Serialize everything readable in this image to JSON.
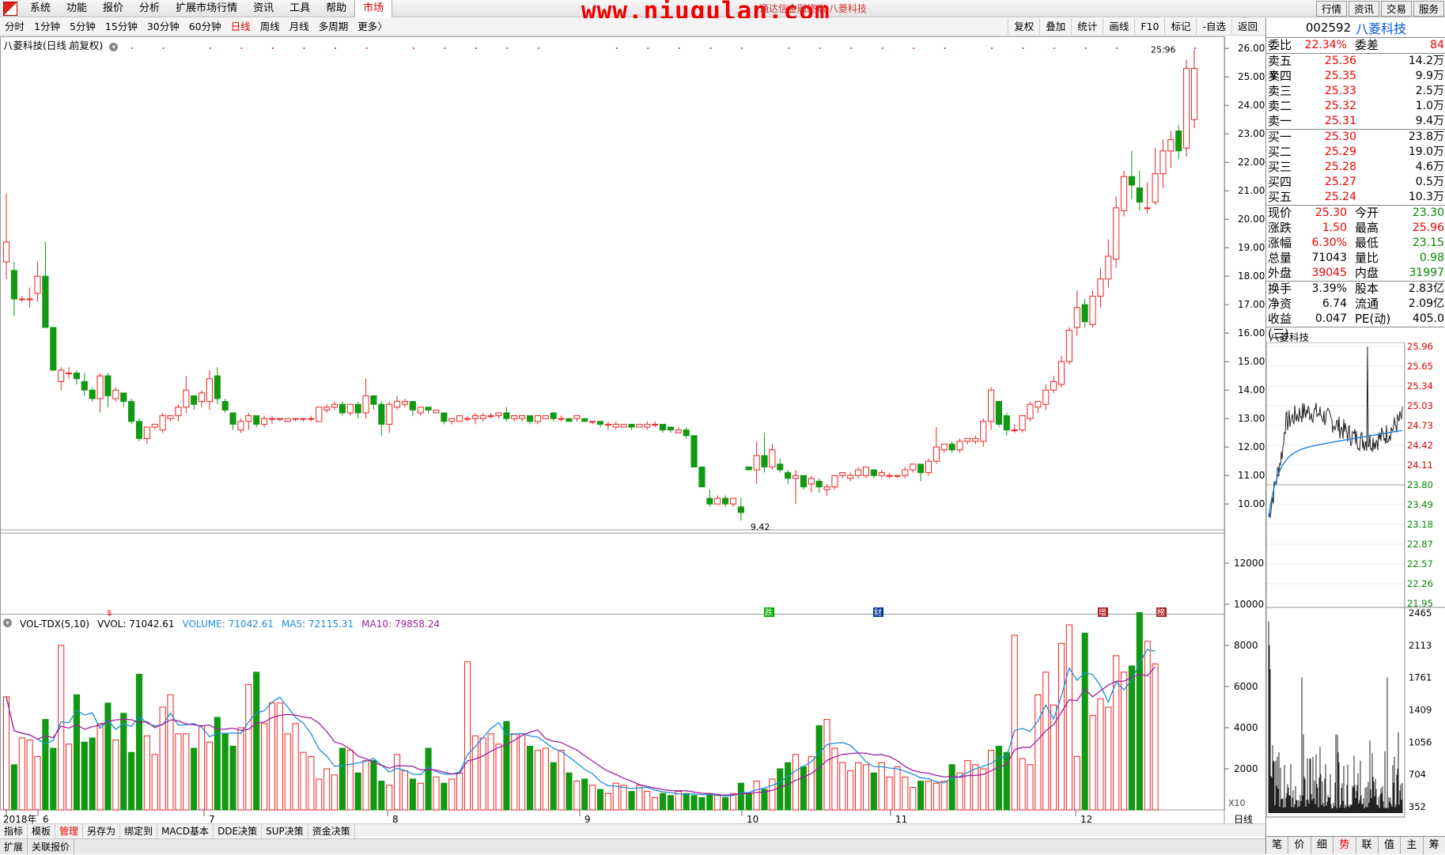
{
  "menu": {
    "items": [
      "系统",
      "功能",
      "报价",
      "分析",
      "扩展市场行情",
      "资讯",
      "工具",
      "帮助"
    ],
    "active": "市场",
    "right_tabs": [
      "行情",
      "资讯",
      "交易",
      "服务"
    ]
  },
  "watermark": "www.niugulan.com",
  "watermark_sub": "通达信金融终端  八菱科技",
  "periods": [
    "分时",
    "1分钟",
    "5分钟",
    "15分钟",
    "30分钟",
    "60分钟",
    "日线",
    "周线",
    "月线",
    "多周期",
    "更多〉"
  ],
  "period_active": "日线",
  "tools": [
    "复权",
    "叠加",
    "统计",
    "画线",
    "F10",
    "标记",
    "-自选",
    "返回"
  ],
  "chart_title": "八菱科技(日线 前复权)",
  "colors": {
    "up": "#ee2222",
    "down": "#119911",
    "ma5": "#1a8fdb",
    "ma10": "#a020a0",
    "axis_red": "#dd0000"
  },
  "chart_data": {
    "type": "candlestick",
    "y_ticks": [
      "26.00",
      "25.00",
      "24.00",
      "23.00",
      "22.00",
      "21.00",
      "20.00",
      "19.00",
      "18.00",
      "17.00",
      "16.00",
      "15.00",
      "14.00",
      "13.00",
      "12.00",
      "11.00",
      "10.00"
    ],
    "ylim": [
      9.2,
      26.2
    ],
    "high_label": "25.96",
    "low_label": "9.42",
    "x_labels": [
      "2018年",
      "6",
      "7",
      "8",
      "9",
      "10",
      "11",
      "12"
    ],
    "x_period": "日线",
    "candles": [
      [
        18.5,
        19.2,
        17.9,
        20.9
      ],
      [
        18.2,
        17.2,
        16.6,
        18.5
      ],
      [
        17.2,
        17.2,
        17.1,
        17.3
      ],
      [
        17.2,
        17.2,
        16.9,
        17.6
      ],
      [
        17.4,
        18.0,
        17.1,
        18.5
      ],
      [
        18.0,
        16.2,
        16.2,
        19.2
      ],
      [
        16.2,
        14.7,
        14.7,
        16.2
      ],
      [
        14.3,
        14.7,
        14.0,
        14.8
      ],
      [
        14.6,
        14.6,
        14.4,
        14.8
      ],
      [
        14.6,
        14.4,
        14.2,
        14.7
      ],
      [
        14.3,
        14.0,
        13.8,
        14.6
      ],
      [
        14.0,
        13.7,
        13.6,
        14.1
      ],
      [
        13.7,
        14.5,
        13.2,
        14.6
      ],
      [
        14.5,
        13.8,
        13.4,
        14.6
      ],
      [
        13.7,
        14.0,
        13.6,
        14.1
      ],
      [
        13.9,
        13.6,
        13.4,
        13.9
      ],
      [
        13.6,
        12.9,
        12.8,
        13.7
      ],
      [
        12.9,
        12.3,
        12.2,
        13.0
      ],
      [
        12.3,
        12.7,
        12.1,
        12.7
      ],
      [
        12.7,
        12.8,
        12.6,
        12.8
      ],
      [
        12.6,
        13.1,
        12.5,
        13.2
      ],
      [
        13.0,
        13.1,
        12.9,
        13.1
      ],
      [
        13.1,
        13.4,
        12.9,
        13.5
      ],
      [
        13.4,
        14.0,
        13.2,
        14.5
      ],
      [
        13.8,
        13.5,
        13.3,
        13.8
      ],
      [
        13.6,
        13.9,
        13.4,
        14.0
      ],
      [
        13.6,
        14.4,
        13.3,
        14.7
      ],
      [
        14.5,
        13.7,
        13.5,
        14.8
      ],
      [
        13.6,
        13.3,
        13.2,
        13.7
      ],
      [
        13.2,
        12.8,
        12.6,
        13.2
      ],
      [
        12.6,
        12.9,
        12.5,
        13.0
      ],
      [
        12.9,
        13.1,
        12.6,
        13.2
      ],
      [
        13.1,
        12.8,
        12.7,
        13.1
      ],
      [
        12.8,
        13.0,
        12.7,
        13.1
      ],
      [
        13.0,
        13.0,
        12.8,
        13.1
      ],
      [
        13.0,
        13.0,
        12.9,
        13.0
      ],
      [
        12.9,
        13.0,
        12.9,
        13.0
      ],
      [
        13.0,
        13.0,
        12.9,
        13.0
      ],
      [
        13.0,
        13.0,
        12.9,
        13.0
      ],
      [
        13.0,
        13.0,
        12.9,
        13.1
      ],
      [
        12.9,
        13.4,
        12.9,
        13.4
      ],
      [
        13.3,
        13.4,
        13.2,
        13.5
      ],
      [
        13.4,
        13.5,
        13.3,
        13.6
      ],
      [
        13.5,
        13.2,
        13.1,
        13.6
      ],
      [
        13.2,
        13.5,
        13.1,
        13.5
      ],
      [
        13.5,
        13.2,
        13.0,
        13.6
      ],
      [
        13.2,
        13.8,
        13.0,
        14.4
      ],
      [
        13.8,
        13.5,
        13.3,
        13.8
      ],
      [
        13.5,
        12.8,
        12.4,
        13.6
      ],
      [
        12.8,
        13.5,
        12.5,
        13.6
      ],
      [
        13.4,
        13.6,
        13.3,
        13.8
      ],
      [
        13.5,
        13.6,
        13.4,
        13.7
      ],
      [
        13.6,
        13.3,
        13.1,
        13.6
      ],
      [
        13.2,
        13.4,
        13.1,
        13.4
      ],
      [
        13.4,
        13.3,
        13.2,
        13.4
      ],
      [
        13.2,
        13.3,
        13.2,
        13.3
      ],
      [
        13.2,
        12.9,
        12.8,
        13.2
      ],
      [
        12.9,
        13.0,
        12.8,
        13.0
      ],
      [
        12.9,
        13.1,
        12.9,
        13.1
      ],
      [
        13.0,
        13.0,
        12.9,
        13.1
      ],
      [
        13.0,
        13.1,
        12.8,
        13.2
      ],
      [
        13.0,
        13.1,
        12.9,
        13.2
      ],
      [
        13.1,
        13.1,
        13.0,
        13.2
      ],
      [
        13.1,
        13.2,
        13.0,
        13.2
      ],
      [
        13.2,
        13.0,
        12.9,
        13.4
      ],
      [
        13.0,
        13.1,
        12.9,
        13.1
      ],
      [
        13.0,
        13.1,
        12.9,
        13.1
      ],
      [
        13.1,
        12.9,
        12.8,
        13.1
      ],
      [
        12.9,
        13.1,
        12.8,
        13.1
      ],
      [
        13.0,
        13.1,
        13.0,
        13.1
      ],
      [
        13.2,
        13.0,
        12.9,
        13.2
      ],
      [
        13.0,
        13.0,
        12.9,
        13.1
      ],
      [
        13.0,
        12.9,
        12.9,
        13.0
      ],
      [
        13.0,
        13.1,
        12.9,
        13.1
      ],
      [
        13.0,
        12.9,
        12.9,
        13.0
      ],
      [
        12.9,
        12.9,
        12.8,
        12.9
      ],
      [
        12.9,
        12.8,
        12.7,
        12.9
      ],
      [
        12.8,
        12.8,
        12.6,
        12.9
      ],
      [
        12.7,
        12.8,
        12.6,
        12.9
      ],
      [
        12.7,
        12.8,
        12.7,
        12.8
      ],
      [
        12.8,
        12.7,
        12.6,
        12.8
      ],
      [
        12.7,
        12.8,
        12.7,
        12.8
      ],
      [
        12.7,
        12.8,
        12.6,
        12.9
      ],
      [
        12.8,
        12.8,
        12.7,
        12.9
      ],
      [
        12.8,
        12.6,
        12.5,
        12.8
      ],
      [
        12.7,
        12.6,
        12.5,
        12.7
      ],
      [
        12.5,
        12.6,
        12.5,
        12.7
      ],
      [
        12.6,
        12.4,
        12.3,
        12.7
      ],
      [
        12.4,
        11.3,
        11.3,
        12.4
      ],
      [
        11.3,
        10.6,
        10.6,
        11.3
      ],
      [
        10.2,
        10.0,
        9.9,
        10.5
      ],
      [
        10.0,
        10.2,
        10.0,
        10.3
      ],
      [
        10.2,
        10.0,
        9.9,
        10.3
      ],
      [
        10.0,
        10.2,
        9.9,
        10.2
      ],
      [
        9.9,
        9.7,
        9.42,
        10.2
      ],
      [
        11.3,
        11.2,
        11.2,
        11.3
      ],
      [
        11.2,
        11.7,
        10.7,
        12.2
      ],
      [
        11.7,
        11.3,
        11.1,
        12.5
      ],
      [
        11.3,
        11.9,
        11.2,
        12.1
      ],
      [
        11.4,
        11.2,
        11.1,
        11.6
      ],
      [
        11.1,
        10.9,
        10.7,
        11.2
      ],
      [
        10.9,
        11.0,
        10.0,
        11.2
      ],
      [
        11.0,
        10.6,
        10.5,
        11.0
      ],
      [
        10.7,
        10.9,
        10.4,
        11.0
      ],
      [
        10.8,
        10.6,
        10.4,
        10.9
      ],
      [
        10.5,
        10.6,
        10.3,
        10.7
      ],
      [
        10.6,
        11.0,
        10.5,
        11.0
      ],
      [
        11.0,
        11.1,
        10.9,
        11.1
      ],
      [
        10.9,
        11.0,
        10.8,
        11.1
      ],
      [
        11.0,
        11.2,
        10.9,
        11.3
      ],
      [
        11.0,
        11.3,
        10.9,
        11.3
      ],
      [
        11.2,
        11.0,
        10.9,
        11.2
      ],
      [
        11.0,
        11.1,
        10.9,
        11.2
      ],
      [
        11.0,
        11.0,
        10.9,
        11.1
      ],
      [
        11.0,
        11.0,
        10.9,
        11.0
      ],
      [
        11.0,
        11.2,
        10.9,
        11.3
      ],
      [
        11.2,
        11.4,
        11.1,
        11.4
      ],
      [
        11.4,
        11.1,
        10.8,
        11.4
      ],
      [
        11.1,
        11.5,
        11.0,
        11.6
      ],
      [
        11.5,
        12.0,
        11.4,
        12.7
      ],
      [
        11.9,
        12.1,
        11.8,
        12.1
      ],
      [
        12.1,
        11.9,
        11.8,
        12.2
      ],
      [
        11.9,
        12.2,
        11.8,
        12.3
      ],
      [
        12.2,
        12.3,
        12.1,
        12.3
      ],
      [
        12.2,
        12.3,
        12.1,
        12.4
      ],
      [
        12.2,
        12.9,
        12.0,
        13.0
      ],
      [
        12.9,
        14.0,
        12.6,
        14.1
      ],
      [
        13.6,
        12.8,
        12.7,
        13.6
      ],
      [
        13.1,
        12.6,
        12.4,
        13.2
      ],
      [
        12.6,
        12.6,
        12.5,
        12.8
      ],
      [
        12.6,
        13.1,
        12.5,
        13.1
      ],
      [
        13.0,
        13.5,
        12.9,
        13.6
      ],
      [
        13.4,
        13.6,
        13.2,
        13.6
      ],
      [
        13.5,
        14.0,
        13.3,
        14.2
      ],
      [
        14.0,
        14.3,
        13.9,
        14.5
      ],
      [
        14.2,
        15.0,
        14.1,
        15.2
      ],
      [
        15.0,
        16.1,
        14.9,
        16.2
      ],
      [
        16.2,
        16.9,
        15.9,
        17.5
      ],
      [
        17.0,
        16.4,
        16.2,
        17.2
      ],
      [
        16.3,
        17.3,
        16.2,
        17.5
      ],
      [
        17.3,
        17.9,
        16.9,
        18.3
      ],
      [
        17.9,
        18.7,
        17.6,
        19.3
      ],
      [
        18.6,
        20.4,
        18.3,
        20.8
      ],
      [
        20.3,
        21.5,
        20.1,
        21.7
      ],
      [
        21.5,
        21.2,
        20.7,
        22.4
      ],
      [
        21.1,
        20.6,
        20.3,
        21.7
      ],
      [
        20.4,
        20.4,
        20.2,
        21.3
      ],
      [
        20.6,
        21.6,
        20.5,
        22.5
      ],
      [
        21.6,
        22.4,
        21.1,
        22.8
      ],
      [
        22.4,
        22.8,
        21.8,
        23.1
      ],
      [
        23.1,
        22.4,
        22.1,
        23.3
      ],
      [
        22.5,
        25.3,
        22.2,
        25.6
      ],
      [
        23.5,
        25.3,
        23.2,
        25.96
      ]
    ],
    "volume": {
      "title": "VOL-TDX(5,10)",
      "vvol_label": "VVOL: 71042.61",
      "volume_label": "VOLUME: 71042.61",
      "ma5_label": "MA5: 72115.31",
      "ma10_label": "MA10: 79858.24",
      "y_ticks": [
        "12000",
        "10000",
        "8000",
        "6000",
        "4000",
        "2000"
      ],
      "ylim": [
        0,
        13000
      ],
      "unit": "X10",
      "values": [
        5500,
        2200,
        3500,
        3400,
        2600,
        4400,
        3000,
        8000,
        3200,
        5600,
        3300,
        3500,
        4200,
        5200,
        3400,
        4700,
        2800,
        6600,
        3600,
        2700,
        5000,
        5600,
        3700,
        3700,
        3000,
        4100,
        3300,
        4500,
        3700,
        3100,
        4000,
        6100,
        6700,
        4200,
        5200,
        5200,
        3700,
        4200,
        2800,
        2600,
        1500,
        2000,
        1700,
        3000,
        2900,
        1800,
        2400,
        2400,
        1400,
        1200,
        2700,
        1900,
        1500,
        1300,
        3000,
        1600,
        1300,
        1500,
        1800,
        7200,
        3600,
        3500,
        3700,
        3200,
        4300,
        3700,
        3700,
        3100,
        2900,
        3000,
        2300,
        2900,
        1800,
        1400,
        1500,
        1200,
        1000,
        800,
        1300,
        1200,
        900,
        1200,
        900,
        600,
        800,
        700,
        900,
        800,
        700,
        600,
        800,
        700,
        600,
        800,
        1300,
        800,
        1400,
        1000,
        1500,
        2000,
        2300,
        2700,
        2100,
        2600,
        4100,
        4400,
        3000,
        2300,
        1900,
        2300,
        2200,
        1800,
        2300,
        1600,
        2100,
        1600,
        1100,
        1400,
        1400,
        1300,
        1400,
        2200,
        1800,
        2400,
        2200,
        2000,
        2900,
        3100,
        2800,
        8500,
        2500,
        2200,
        5600,
        6700,
        5100,
        8100,
        9000,
        2600,
        8600,
        4600,
        5400,
        5000,
        7500,
        6700,
        7000,
        9600,
        8200,
        7100
      ]
    }
  },
  "chart_markers": {
    "s": "$",
    "die": "跌",
    "cai": "财",
    "zeng": "增",
    "bang": "榜"
  },
  "bottom_bar1": [
    "指标",
    "模板",
    "管理",
    "另存为",
    "绑定到",
    "MACD基本",
    "DDE决策",
    "SUP决策",
    "资金决策"
  ],
  "bottom_bar1_active": "管理",
  "bottom_bar2": [
    "扩展",
    "关联报价"
  ],
  "quote": {
    "code": "002592",
    "name": "八菱科技",
    "weibi_label": "委比",
    "weibi": "22.34%",
    "weicha_label": "委差",
    "weicha": "84",
    "asks": [
      {
        "label": "卖五￥",
        "price": "25.36",
        "vol": "14.2万"
      },
      {
        "label": "卖四",
        "price": "25.35",
        "vol": "9.9万"
      },
      {
        "label": "卖三",
        "price": "25.33",
        "vol": "2.5万"
      },
      {
        "label": "卖二",
        "price": "25.32",
        "vol": "1.0万"
      },
      {
        "label": "卖一",
        "price": "25.31",
        "vol": "9.4万"
      }
    ],
    "bids": [
      {
        "label": "买一",
        "price": "25.30",
        "vol": "23.8万"
      },
      {
        "label": "买二",
        "price": "25.29",
        "vol": "19.0万"
      },
      {
        "label": "买三",
        "price": "25.28",
        "vol": "4.6万"
      },
      {
        "label": "买四",
        "price": "25.27",
        "vol": "0.5万"
      },
      {
        "label": "买五",
        "price": "25.24",
        "vol": "10.3万"
      }
    ],
    "stats": [
      {
        "l": "现价",
        "v": "25.30",
        "vc": "red",
        "l2": "今开",
        "v2": "23.30",
        "v2c": "grn"
      },
      {
        "l": "涨跌",
        "v": "1.50",
        "vc": "red",
        "l2": "最高",
        "v2": "25.96",
        "v2c": "red"
      },
      {
        "l": "涨幅",
        "v": "6.30%",
        "vc": "red",
        "l2": "最低",
        "v2": "23.15",
        "v2c": "grn"
      },
      {
        "l": "总量",
        "v": "71043",
        "vc": "",
        "l2": "量比",
        "v2": "0.98",
        "v2c": "grn"
      },
      {
        "l": "外盘",
        "v": "39045",
        "vc": "red",
        "l2": "内盘",
        "v2": "31997",
        "v2c": "grn"
      }
    ],
    "stats2": [
      {
        "l": "换手",
        "v": "3.39%",
        "l2": "股本",
        "v2": "2.83亿"
      },
      {
        "l": "净资",
        "v": "6.74",
        "l2": "流通",
        "v2": "2.09亿"
      },
      {
        "l": "收益(三)",
        "v": "0.047",
        "l2": "PE(动)",
        "v2": "405.0"
      }
    ]
  },
  "mini": {
    "title": "八菱科技",
    "price_ticks": [
      "25.96",
      "25.65",
      "25.34",
      "25.03",
      "24.73",
      "24.42",
      "24.11",
      "23.80",
      "23.49",
      "23.18",
      "22.87",
      "22.57",
      "22.26",
      "21.95"
    ],
    "vol_ticks": [
      "2465",
      "2113",
      "1761",
      "1409",
      "1056",
      "704",
      "352"
    ],
    "tabs": [
      "笔",
      "价",
      "细",
      "势",
      "联",
      "值",
      "主",
      "筹"
    ],
    "active_tab": "势"
  }
}
